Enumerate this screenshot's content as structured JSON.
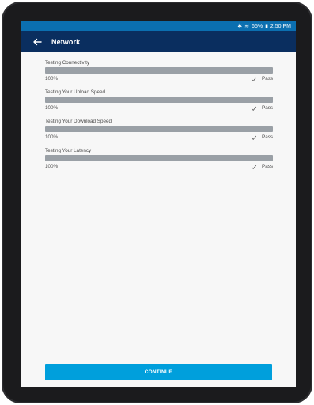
{
  "status_bar": {
    "battery": "65%",
    "time": "2:50 PM"
  },
  "app_bar": {
    "title": "Network",
    "back_icon": "arrow-left-icon"
  },
  "tests": [
    {
      "label": "Testing Connectivity",
      "progress_percent": 100,
      "percent_text": "100%",
      "result": "Pass"
    },
    {
      "label": "Testing Your Upload Speed",
      "progress_percent": 100,
      "percent_text": "100%",
      "result": "Pass"
    },
    {
      "label": "Testing Your Download Speed",
      "progress_percent": 100,
      "percent_text": "100%",
      "result": "Pass"
    },
    {
      "label": "Testing Your Latency",
      "progress_percent": 100,
      "percent_text": "100%",
      "result": "Pass"
    }
  ],
  "button": {
    "continue_label": "CONTINUE"
  },
  "colors": {
    "status_bar": "#0b6fb0",
    "app_bar": "#0a2e5f",
    "progress_fill": "#9aa0a6",
    "continue_button": "#009fdc"
  }
}
